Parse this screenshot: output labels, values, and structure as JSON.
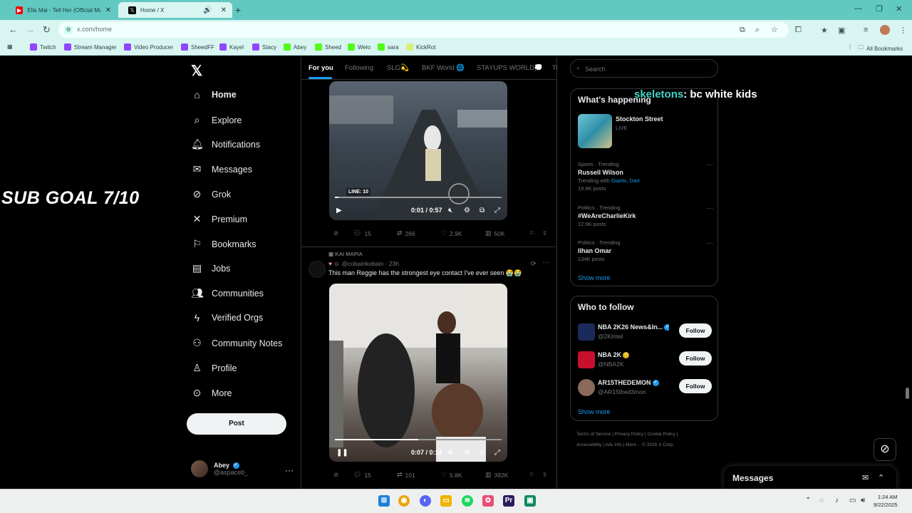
{
  "browser": {
    "tabs": [
      {
        "title": "Ella Mai - Tell Her (Official Musi",
        "icon": "youtube-icon",
        "color": "#ff0000"
      },
      {
        "title": "Home / X",
        "icon": "x-logo-icon",
        "color": "#000000"
      }
    ],
    "url": "x.com/home",
    "bookmarks": [
      "Twitch",
      "Stream Manager",
      "Video Producer",
      "SheedFF",
      "Kayel",
      "Stacy",
      "Abey",
      "Sheed",
      "Welo",
      "sara",
      "KickRot"
    ],
    "all_bookmarks": "All Bookmarks"
  },
  "x": {
    "nav": [
      {
        "label": "Home",
        "icon": "home-icon"
      },
      {
        "label": "Explore",
        "icon": "search-icon"
      },
      {
        "label": "Notifications",
        "icon": "bell-icon"
      },
      {
        "label": "Messages",
        "icon": "envelope-icon"
      },
      {
        "label": "Grok",
        "icon": "grok-icon"
      },
      {
        "label": "Premium",
        "icon": "x-logo-icon"
      },
      {
        "label": "Bookmarks",
        "icon": "bookmark-icon"
      },
      {
        "label": "Jobs",
        "icon": "briefcase-icon"
      },
      {
        "label": "Communities",
        "icon": "people-icon"
      },
      {
        "label": "Verified Orgs",
        "icon": "lightning-icon"
      },
      {
        "label": "Community Notes",
        "icon": "community-notes-icon"
      },
      {
        "label": "Profile",
        "icon": "person-icon"
      },
      {
        "label": "More",
        "icon": "more-circle-icon"
      }
    ],
    "post_button": "Post",
    "account": {
      "name": "Abey",
      "handle": "@aspaceb_"
    },
    "feed_tabs": [
      "For you",
      "Following",
      "SLG💫",
      "BKF World 🌐",
      "STAYUPS WORLD💭",
      "Ti"
    ],
    "video1": {
      "time": "0:01 / 0:57",
      "badge": "LINE: 10",
      "progress": 0.02,
      "stats": {
        "replies": "15",
        "reposts": "266",
        "likes": "2.9K",
        "views": "50K"
      }
    },
    "tweet2": {
      "context": "KAI MAFIA",
      "handle": "@cobainkobain",
      "age": "23h",
      "text": "This man Reggie has the strongest eye contact I've ever seen 😭😭",
      "video_time": "0:07 / 0:14",
      "progress": 0.5,
      "stats": {
        "replies": "15",
        "reposts": "101",
        "likes": "5.8K",
        "views": "392K"
      }
    },
    "search_placeholder": "Search",
    "whats_happening": {
      "title": "What's happening",
      "live": {
        "name": "Stockton Street",
        "tag": "LIVE"
      },
      "trends": [
        {
          "meta": "Sports · Trending",
          "name": "Russell Wilson",
          "sub_prefix": "Trending with ",
          "sub_links": "Giants, Dart",
          "count": "19.9K posts"
        },
        {
          "meta": "Politics · Trending",
          "name": "#WeAreCharlieKirk",
          "count": "12.9K posts"
        },
        {
          "meta": "Politics · Trending",
          "name": "Ilhan Omar",
          "count": "134K posts"
        }
      ],
      "show_more": "Show more"
    },
    "who_to_follow": {
      "title": "Who to follow",
      "accounts": [
        {
          "name": "NBA 2K26 News&In...",
          "handle": "@2KIntel",
          "badge_color": "#1d9bf0",
          "avatar_color": "#1a2a5a"
        },
        {
          "name": "NBA 2K",
          "handle": "@NBA2K",
          "badge_color": "#e2b719",
          "avatar_color": "#c8102e"
        },
        {
          "name": "AR15THEDEMON",
          "handle": "@AR15thed3mon",
          "badge_color": "#1d9bf0",
          "avatar_color": "#8a6a5a"
        }
      ],
      "follow_label": "Follow",
      "show_more": "Show more"
    },
    "footer": {
      "line1": "Terms of Service  |  Privacy Policy  |  Cookie Policy  |",
      "line2": "Accessibility  |  Ads info  |  More···  © 2025 X Corp."
    },
    "messages_drawer": "Messages"
  },
  "overlay": {
    "sub_goal": "SUB GOAL 7/10",
    "chat_user": "skeletons",
    "chat_text": ": bc white kids"
  },
  "taskbar": {
    "time": "1:24 AM",
    "date": "9/22/2025"
  }
}
